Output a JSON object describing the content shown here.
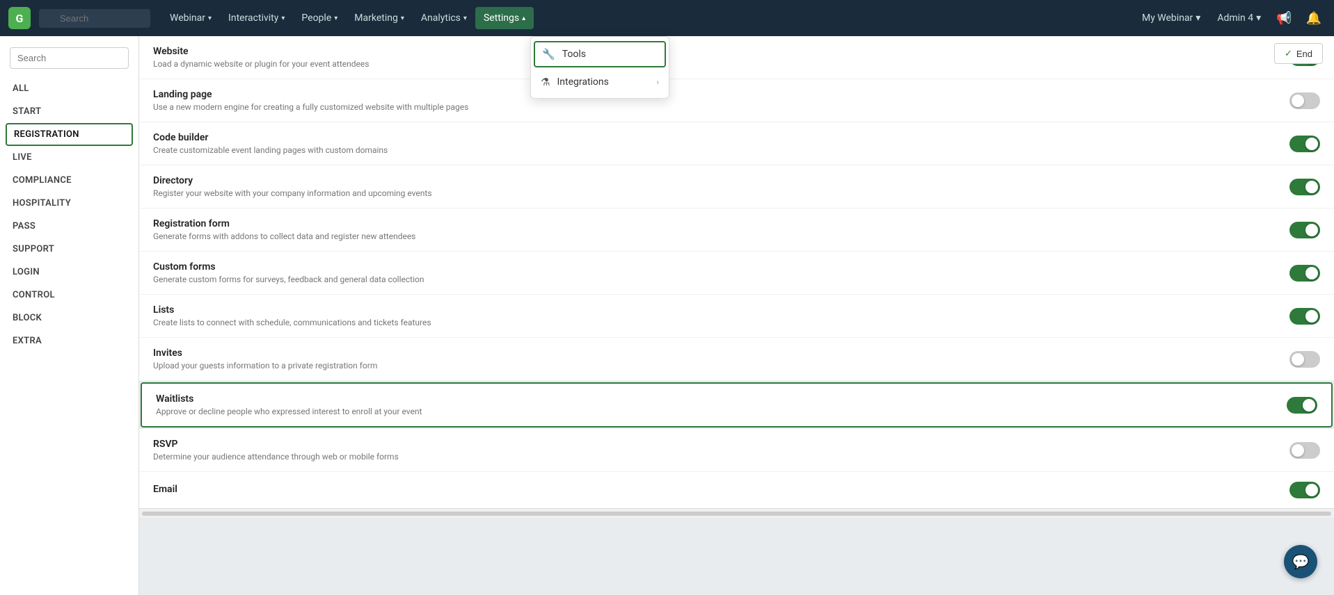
{
  "topnav": {
    "logo": "G",
    "search_placeholder": "Search",
    "nav_items": [
      {
        "label": "Webinar",
        "has_chevron": true,
        "active": false
      },
      {
        "label": "Interactivity",
        "has_chevron": true,
        "active": false
      },
      {
        "label": "People",
        "has_chevron": true,
        "active": false
      },
      {
        "label": "Marketing",
        "has_chevron": true,
        "active": false
      },
      {
        "label": "Analytics",
        "has_chevron": true,
        "active": false
      },
      {
        "label": "Settings",
        "has_chevron": true,
        "active": true
      }
    ],
    "my_webinar_label": "My Webinar",
    "admin_label": "Admin 4",
    "end_label": "End"
  },
  "dropdown": {
    "tools_label": "Tools",
    "integrations_label": "Integrations"
  },
  "sidebar": {
    "search_placeholder": "Search",
    "items": [
      {
        "label": "ALL",
        "active": false
      },
      {
        "label": "START",
        "active": false
      },
      {
        "label": "REGISTRATION",
        "active": true
      },
      {
        "label": "LIVE",
        "active": false
      },
      {
        "label": "COMPLIANCE",
        "active": false
      },
      {
        "label": "HOSPITALITY",
        "active": false
      },
      {
        "label": "PASS",
        "active": false
      },
      {
        "label": "SUPPORT",
        "active": false
      },
      {
        "label": "LOGIN",
        "active": false
      },
      {
        "label": "CONTROL",
        "active": false
      },
      {
        "label": "BLOCK",
        "active": false
      },
      {
        "label": "EXTRA",
        "active": false
      }
    ]
  },
  "features": [
    {
      "title": "Website",
      "desc": "Load a dynamic website or plugin for your event attendees",
      "toggle": "on",
      "highlighted": false
    },
    {
      "title": "Landing page",
      "desc": "Use a new modern engine for creating a fully customized website with multiple pages",
      "toggle": "off",
      "highlighted": false
    },
    {
      "title": "Code builder",
      "desc": "Create customizable event landing pages with custom domains",
      "toggle": "on",
      "highlighted": false
    },
    {
      "title": "Directory",
      "desc": "Register your website with your company information and upcoming events",
      "toggle": "on",
      "highlighted": false
    },
    {
      "title": "Registration form",
      "desc": "Generate forms with addons to collect data and register new attendees",
      "toggle": "on",
      "highlighted": false
    },
    {
      "title": "Custom forms",
      "desc": "Generate custom forms for surveys, feedback and general data collection",
      "toggle": "on",
      "highlighted": false
    },
    {
      "title": "Lists",
      "desc": "Create lists to connect with schedule, communications and tickets features",
      "toggle": "on",
      "highlighted": false
    },
    {
      "title": "Invites",
      "desc": "Upload your guests information to a private registration form",
      "toggle": "off",
      "highlighted": false
    },
    {
      "title": "Waitlists",
      "desc": "Approve or decline people who expressed interest to enroll at your event",
      "toggle": "on",
      "highlighted": true
    },
    {
      "title": "RSVP",
      "desc": "Determine your audience attendance through web or mobile forms",
      "toggle": "off",
      "highlighted": false
    },
    {
      "title": "Email",
      "desc": "",
      "toggle": "on",
      "highlighted": false
    }
  ]
}
